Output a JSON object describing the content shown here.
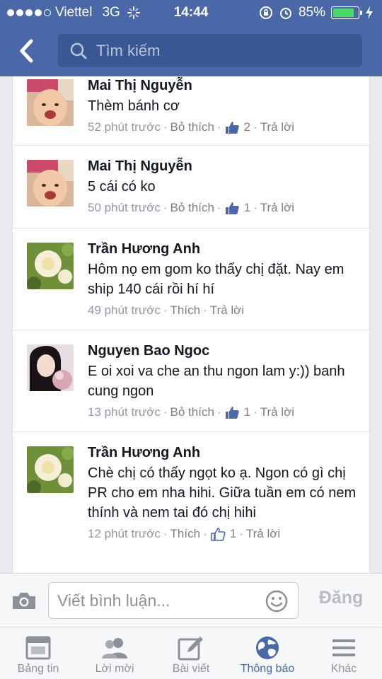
{
  "status_bar": {
    "carrier": "Viettel",
    "network": "3G",
    "time": "14:44",
    "battery": "85%",
    "battery_level": 0.85
  },
  "search": {
    "placeholder": "Tìm kiếm"
  },
  "comments": [
    {
      "name": "Mai Thị Nguyễn",
      "text": "Thèm bánh cơ",
      "time": "52 phút trước",
      "action": "Bỏ thích",
      "likes": "2",
      "reply": "Trả lời",
      "avatar": "baby-photo"
    },
    {
      "name": "Mai Thị Nguyễn",
      "text": "5 cái có ko",
      "time": "50 phút trước",
      "action": "Bỏ thích",
      "likes": "1",
      "reply": "Trả lời",
      "avatar": "baby-photo"
    },
    {
      "name": "Trần Hương Anh",
      "text": "Hôm nọ em gom ko thấy chị đặt. Nay em ship 140 cái rồi hí hí",
      "time": "49 phút trước",
      "action": "Thích",
      "likes": "",
      "reply": "Trả lời",
      "avatar": "white-rose-photo"
    },
    {
      "name": "Nguyen Bao Ngoc",
      "text": "E oi xoi va che an thu ngon lam y:)) banh cung ngon",
      "time": "13 phút trước",
      "action": "Bỏ thích",
      "likes": "1",
      "reply": "Trả lời",
      "avatar": "girl-photo"
    },
    {
      "name": "Trần Hương Anh",
      "text": "Chè chị có thấy ngọt ko ạ. Ngon có gì chị PR cho em nha hihi. Giữa tuần em có nem thính và nem tai đó chị hihi",
      "time": "12 phút trước",
      "action": "Thích",
      "likes": "1",
      "reply": "Trả lời",
      "avatar": "white-rose-photo"
    }
  ],
  "composer": {
    "placeholder": "Viết bình luận...",
    "post_label": "Đăng"
  },
  "tabs": [
    {
      "label": "Bảng tin",
      "icon": "news-feed-icon"
    },
    {
      "label": "Lời mời",
      "icon": "friend-requests-icon"
    },
    {
      "label": "Bài viết",
      "icon": "compose-icon"
    },
    {
      "label": "Thông báo",
      "icon": "globe-icon",
      "active": true
    },
    {
      "label": "Khác",
      "icon": "menu-icon"
    }
  ],
  "colors": {
    "brand": "#4a67a7",
    "like_blue": "#4a67a7",
    "meta_gray": "#9197a3"
  }
}
